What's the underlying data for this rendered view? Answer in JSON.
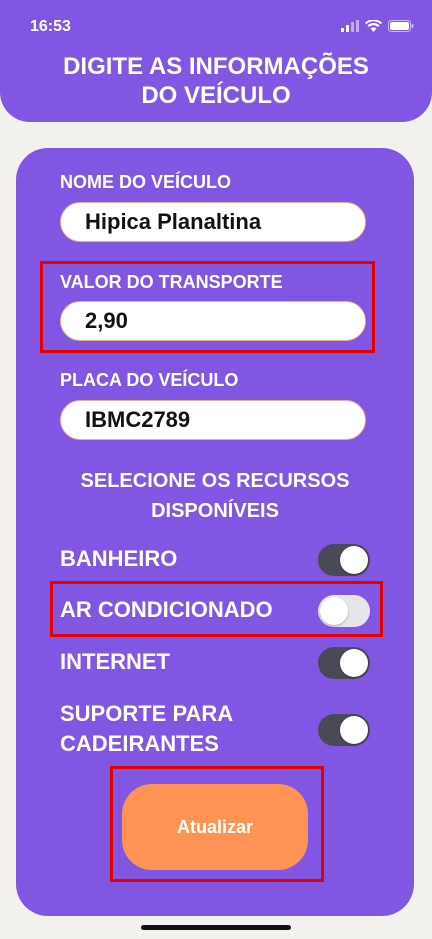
{
  "status_bar": {
    "time": "16:53"
  },
  "header": {
    "title_line1": "DIGITE AS INFORMAÇÕES",
    "title_line2": "DO VEÍCULO"
  },
  "form": {
    "vehicle_name_label": "NOME DO VEÍCULO",
    "vehicle_name_value": "Hipica Planaltina",
    "transport_value_label": "VALOR DO TRANSPORTE",
    "transport_value": "2,90",
    "plate_label": "PLACA DO VEÍCULO",
    "plate_value": "IBMC2789"
  },
  "features": {
    "title_line1": "SELECIONE OS RECURSOS",
    "title_line2": "DISPONÍVEIS",
    "items": [
      {
        "label": "BANHEIRO",
        "on": true
      },
      {
        "label": "AR CONDICIONADO",
        "on": false
      },
      {
        "label": "INTERNET",
        "on": true
      },
      {
        "label_line1": "SUPORTE PARA",
        "label_line2": "CADEIRANTES",
        "on": true
      }
    ]
  },
  "actions": {
    "update_label": "Atualizar"
  },
  "colors": {
    "primary": "#8056e3",
    "button": "#fe9354",
    "highlight": "#e50000",
    "background": "#f2f1ee"
  }
}
